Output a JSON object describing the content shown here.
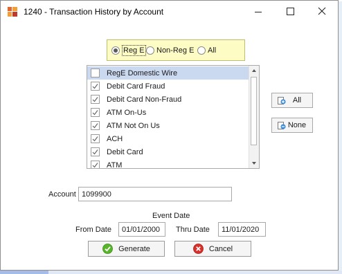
{
  "window": {
    "title": "1240 - Transaction History by Account",
    "controls": [
      "minimize-icon",
      "maximize-icon",
      "close-icon"
    ]
  },
  "reg_filter": {
    "options": [
      {
        "label": "Reg E",
        "selected": true
      },
      {
        "label": "Non-Reg E",
        "selected": false
      },
      {
        "label": "All",
        "selected": false
      }
    ]
  },
  "transaction_types": {
    "items": [
      {
        "label": "RegE Domestic Wire",
        "checked": false,
        "highlighted": true
      },
      {
        "label": "Debit Card Fraud",
        "checked": true,
        "highlighted": false
      },
      {
        "label": "Debit Card Non-Fraud",
        "checked": true,
        "highlighted": false
      },
      {
        "label": "ATM On-Us",
        "checked": true,
        "highlighted": false
      },
      {
        "label": "ATM Not On Us",
        "checked": true,
        "highlighted": false
      },
      {
        "label": "ACH",
        "checked": true,
        "highlighted": false
      },
      {
        "label": "Debit Card",
        "checked": true,
        "highlighted": false
      },
      {
        "label": "ATM",
        "checked": true,
        "highlighted": false
      }
    ]
  },
  "select_buttons": {
    "all_label": "All",
    "none_label": "None"
  },
  "account": {
    "label": "Account",
    "value": "1099900"
  },
  "event_date": {
    "heading": "Event Date",
    "from_label": "From Date",
    "from_value": "01/01/2000",
    "thru_label": "Thru Date",
    "thru_value": "11/01/2020"
  },
  "actions": {
    "generate_label": "Generate",
    "cancel_label": "Cancel"
  },
  "colors": {
    "radio_panel_bg": "#fdfcc4",
    "selection_bg": "#cad9f0",
    "generate_icon": "#5ab52c",
    "cancel_icon": "#d9302a",
    "app_icon_orange": "#e8632b",
    "app_icon_red": "#c0392b"
  }
}
